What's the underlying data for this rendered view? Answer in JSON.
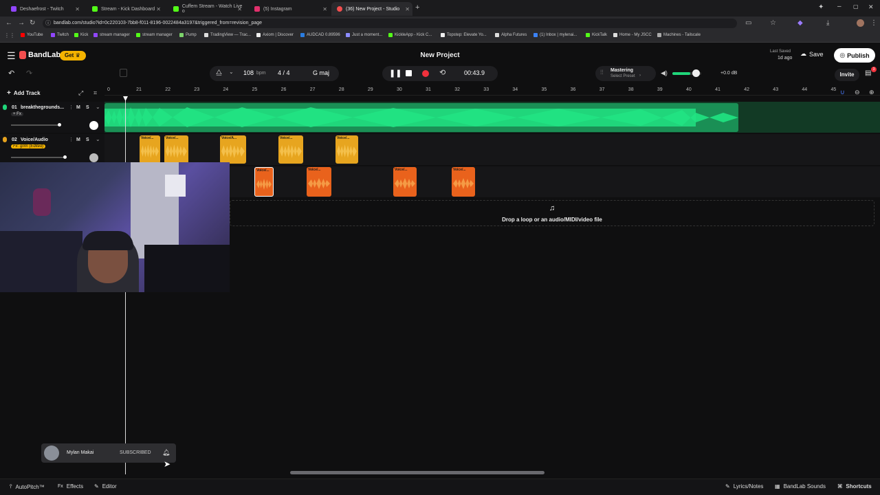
{
  "browser": {
    "tabs": [
      {
        "label": "Deshaefrost - Twitch",
        "color": "#9146ff"
      },
      {
        "label": "Stream - Kick Dashboard",
        "color": "#53fc18"
      },
      {
        "label": "Cuffem Stream - Watch Live o",
        "color": "#53fc18"
      },
      {
        "label": "(5) Instagram",
        "color": "#e1306c"
      },
      {
        "label": "(36) New Project - Studio",
        "color": "#f24e4e"
      }
    ],
    "url": "bandlab.com/studio?id=0c220103-7bb8-f011-8196-0022484a3197&triggered_from=revision_page",
    "bookmarks": [
      "YouTube",
      "Twitch",
      "Kick",
      "stream manager",
      "stream manager",
      "Pump",
      "TradingView — Trac...",
      "Axiom | Discover",
      "AUDCAD 0.89596",
      "Just a moment...",
      "KickleApp - Kick C...",
      "Topstep: Elevate Yo...",
      "Alpha Futures",
      "(1) Inbox | mylenai...",
      "KickTalk",
      "Home - My JSCC",
      "Machines - Tailscale"
    ]
  },
  "header": {
    "brand": "BandLab",
    "get_label": "Get",
    "project_title": "New Project",
    "last_saved_label": "Last Saved",
    "last_saved_value": "1d ago",
    "save_label": "Save",
    "publish_label": "Publish",
    "invite_label": "Invite",
    "notif_count": "3"
  },
  "transport": {
    "bpm": "108",
    "bpm_unit": "bpm",
    "time_sig": "4 / 4",
    "key": "G maj",
    "time": "00:43.9",
    "mastering_label": "Mastering",
    "preset_label": "Select Preset",
    "volume_db": "+0.0 dB"
  },
  "ruler_marks": [
    "0",
    "21",
    "22",
    "23",
    "24",
    "25",
    "26",
    "27",
    "28",
    "29",
    "30",
    "31",
    "32",
    "33",
    "34",
    "35",
    "36",
    "37",
    "38",
    "39",
    "40",
    "41",
    "42",
    "43",
    "44",
    "45"
  ],
  "tracks": [
    {
      "num": "01",
      "name": "breakthegrounds...",
      "tag": "+ Fx",
      "mute": "M",
      "solo": "S",
      "color": "#1fd67a"
    },
    {
      "num": "02",
      "name": "Voice/Audio",
      "tag": "Fx: grim (Edited)",
      "mute": "M",
      "solo": "S",
      "color": "#e6a21e"
    }
  ],
  "add_track_label": "Add Track",
  "voice_clip_label": "Voice/...",
  "voice_clip_label_2": "Voice/A...",
  "drop_text": "Drop a loop or an audio/MIDI/video file",
  "overlay": {
    "user_name": "Mylan Makai",
    "subscribed_label": "SUBSCRIBED"
  },
  "bottom": {
    "autopitch": "AutoPitch™",
    "effects": "Effects",
    "editor": "Editor",
    "lyrics": "Lyrics/Notes",
    "sounds": "BandLab Sounds",
    "shortcuts": "Shortcuts"
  }
}
